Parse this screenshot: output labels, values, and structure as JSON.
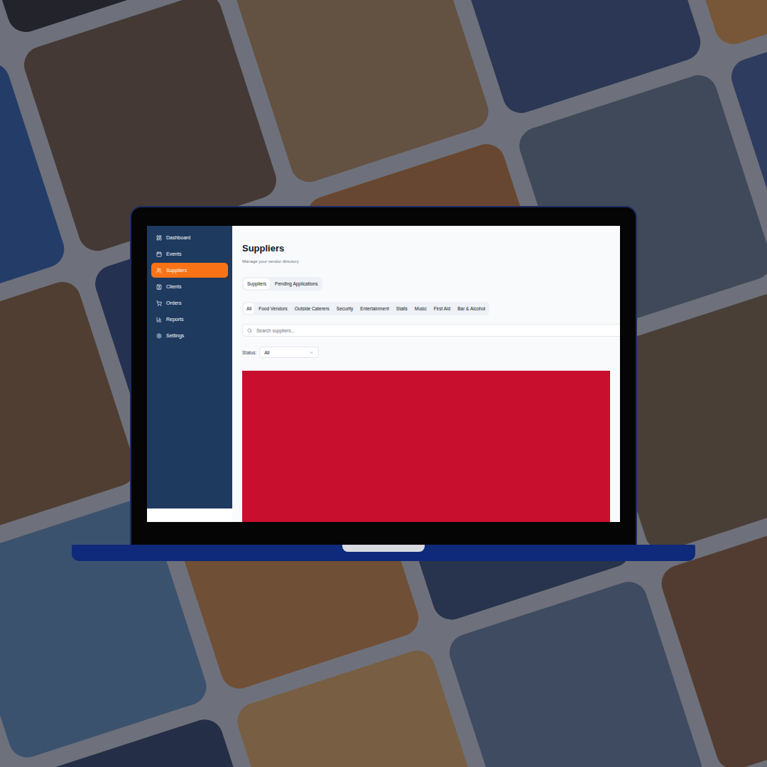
{
  "sidebar": {
    "items": [
      {
        "label": "Dashboard",
        "selected": false
      },
      {
        "label": "Events",
        "selected": false
      },
      {
        "label": "Suppliers",
        "selected": true
      },
      {
        "label": "Clients",
        "selected": false
      },
      {
        "label": "Orders",
        "selected": false
      },
      {
        "label": "Reports",
        "selected": false
      },
      {
        "label": "Settings",
        "selected": false
      }
    ]
  },
  "page": {
    "title": "Suppliers",
    "subtitle": "Manage your vendor directory"
  },
  "tabs": [
    {
      "label": "Suppliers",
      "selected": true
    },
    {
      "label": "Pending Applications",
      "selected": false
    }
  ],
  "filters": [
    {
      "label": "All",
      "selected": true
    },
    {
      "label": "Food Vendors",
      "selected": false
    },
    {
      "label": "Outside Caterers",
      "selected": false
    },
    {
      "label": "Security",
      "selected": false
    },
    {
      "label": "Entertainment",
      "selected": false
    },
    {
      "label": "Stalls",
      "selected": false
    },
    {
      "label": "Music",
      "selected": false
    },
    {
      "label": "First Aid",
      "selected": false
    },
    {
      "label": "Bar & Alcohol",
      "selected": false
    }
  ],
  "search": {
    "placeholder": "Search suppliers..."
  },
  "status": {
    "label": "Status:",
    "value": "All"
  }
}
